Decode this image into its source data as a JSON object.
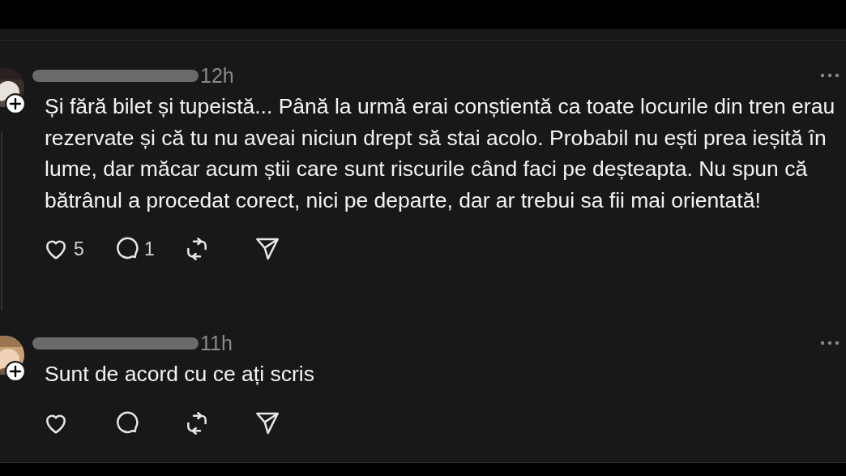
{
  "posts": [
    {
      "time": "12h",
      "text": "Și fără bilet și tupeistă... Până la urmă erai conștientă ca toate locurile din tren erau rezervate și că tu nu aveai niciun drept să stai acolo. Probabil nu ești prea ieșită în lume, dar măcar acum știi care sunt riscurile când faci pe deșteapta. Nu spun că bătrânul a procedat corect, nici pe departe, dar ar trebui sa fii mai orientată!",
      "likes": "5",
      "replies": "1",
      "thread_line": true
    },
    {
      "time": "11h",
      "text": "Sunt de acord cu ce ați scris",
      "thread_line": false
    }
  ]
}
